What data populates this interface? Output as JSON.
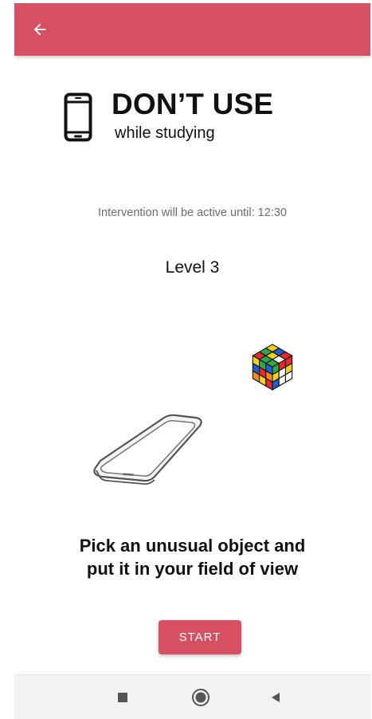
{
  "app_bar": {
    "back_icon": "arrow-left-icon",
    "color": "#d65062"
  },
  "header": {
    "icon": "smartphone-icon",
    "title": "DON’T USE",
    "subtitle": "while studying"
  },
  "intervention": {
    "text": "Intervention will be active until: 12:30"
  },
  "level": {
    "text": "Level 3"
  },
  "illustrations": {
    "cube": "rubiks-cube-icon",
    "phone": "phone-outline-icon"
  },
  "instruction": {
    "line1": "Pick an unusual object and",
    "line2": "put it in your field of view"
  },
  "start_button": {
    "label": "START",
    "color": "#d65062"
  },
  "nav_bar": {
    "recents_icon": "square-icon",
    "home_icon": "circle-icon",
    "back_icon": "triangle-back-icon"
  }
}
